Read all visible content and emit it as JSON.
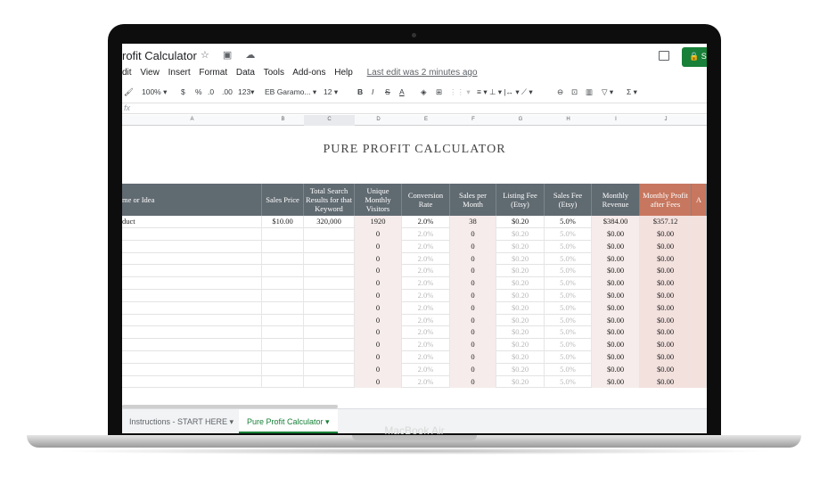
{
  "device_label": "MacBook Air",
  "app": {
    "doc_title": "rofit Calculator",
    "title_icons": "☆ ▣ ☁",
    "share_label": "S",
    "menu": [
      "dit",
      "View",
      "Insert",
      "Format",
      "Data",
      "Tools",
      "Add-ons",
      "Help"
    ],
    "last_edit": "Last edit was 2 minutes ago"
  },
  "toolbar": {
    "paint": "🖌",
    "zoom": "100% ▾",
    "currency": "$",
    "percent": "%",
    "dec_less": ".0",
    "dec_more": ".00",
    "format": "123▾",
    "font": "EB Garamo... ▾",
    "size": "12 ▾",
    "bold": "B",
    "italic": "I",
    "strike": "S",
    "textcolor": "A",
    "fill": "◈",
    "borders": "⊞",
    "merge": "⋮⋮ ▾",
    "align": "≡ ▾ ⊥ ▾ |↔ ▾ ⟋ ▾",
    "link": "⊖",
    "comment": "⊡",
    "chart": "▥",
    "filter": "▽ ▾",
    "functions": "Σ ▾"
  },
  "formula_bar": {
    "fx": "fx"
  },
  "columns": [
    "A",
    "B",
    "C",
    "D",
    "E",
    "F",
    "G",
    "H",
    "I",
    "J"
  ],
  "sheet": {
    "title": "PURE PROFIT CALCULATOR",
    "headers": [
      "me or Idea",
      "Sales Price",
      "Total Search Results for that Keyword",
      "Unique Monthly Visitors",
      "Conversion Rate",
      "Sales per Month",
      "Listing Fee (Etsy)",
      "Sales Fee (Etsy)",
      "Monthly Revenue",
      "Monthly Profit after Fees",
      "A"
    ],
    "first_row": [
      "duct",
      "$10.00",
      "320,000",
      "1920",
      "2.0%",
      "38",
      "$0.20",
      "5.0%",
      "$384.00",
      "$357.12"
    ],
    "empty_row": {
      "visitors": "0",
      "conversion": "2.0%",
      "sales": "0",
      "listing": "$0.20",
      "fee": "5.0%",
      "revenue": "$0.00",
      "profit": "$0.00"
    }
  },
  "tabs": {
    "inactive": "Instructions - START HERE ▾",
    "active": "Pure Profit Calculator ▾"
  }
}
